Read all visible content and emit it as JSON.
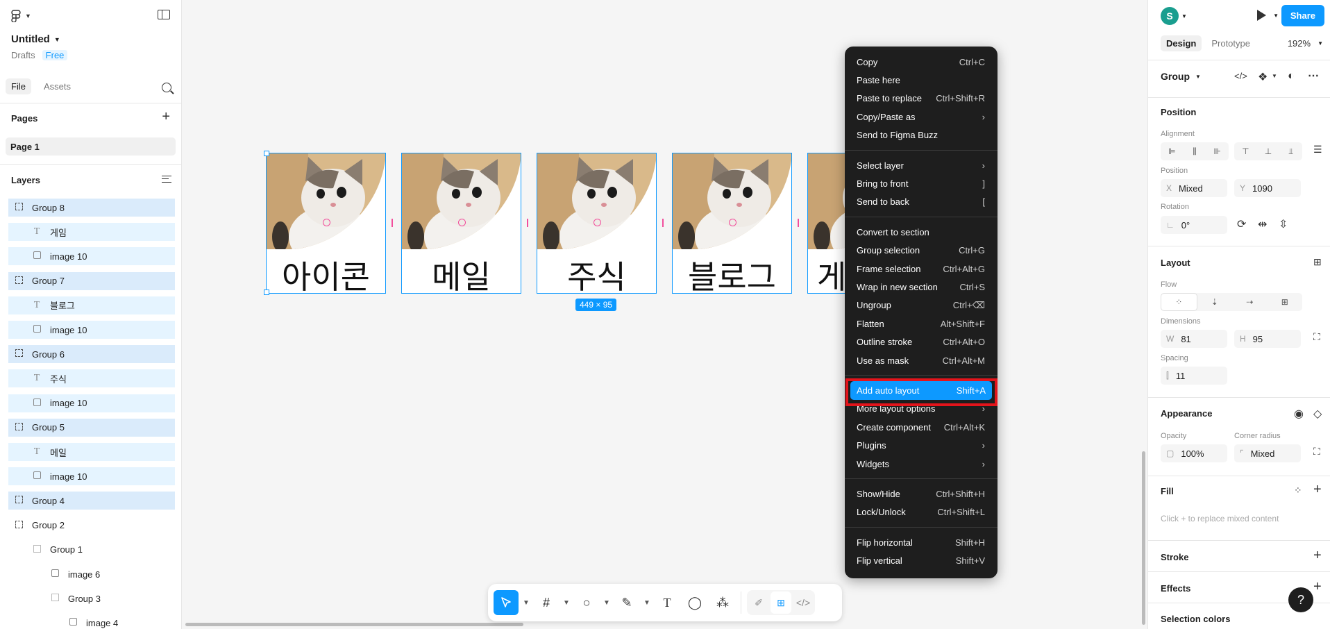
{
  "app": {
    "file_name": "Untitled",
    "location": "Drafts",
    "plan_badge": "Free"
  },
  "left_panel": {
    "tabs": [
      "File",
      "Assets"
    ],
    "pages_header": "Pages",
    "current_page": "Page 1",
    "layers_header": "Layers",
    "layers": [
      {
        "name": "Group 8",
        "type": "group",
        "indent": 0,
        "selected": true
      },
      {
        "name": "게임",
        "type": "text",
        "indent": 1,
        "selected": true
      },
      {
        "name": "image 10",
        "type": "image",
        "indent": 1,
        "selected": true
      },
      {
        "name": "Group 7",
        "type": "group",
        "indent": 0,
        "selected": true
      },
      {
        "name": "블로그",
        "type": "text",
        "indent": 1,
        "selected": true
      },
      {
        "name": "image 10",
        "type": "image",
        "indent": 1,
        "selected": true
      },
      {
        "name": "Group 6",
        "type": "group",
        "indent": 0,
        "selected": true
      },
      {
        "name": "주식",
        "type": "text",
        "indent": 1,
        "selected": true
      },
      {
        "name": "image 10",
        "type": "image",
        "indent": 1,
        "selected": true
      },
      {
        "name": "Group 5",
        "type": "group",
        "indent": 0,
        "selected": true
      },
      {
        "name": "메일",
        "type": "text",
        "indent": 1,
        "selected": true
      },
      {
        "name": "image 10",
        "type": "image",
        "indent": 1,
        "selected": true
      },
      {
        "name": "Group 4",
        "type": "group",
        "indent": 0,
        "selected": true
      },
      {
        "name": "Group 2",
        "type": "group",
        "indent": 0,
        "selected": false
      },
      {
        "name": "Group 1",
        "type": "frame",
        "indent": 1,
        "selected": false
      },
      {
        "name": "image 6",
        "type": "image",
        "indent": 2,
        "selected": false
      },
      {
        "name": "Group 3",
        "type": "frame",
        "indent": 2,
        "selected": false
      },
      {
        "name": "image 4",
        "type": "image",
        "indent": 3,
        "selected": false
      }
    ]
  },
  "canvas": {
    "cards": [
      {
        "label": "아이콘"
      },
      {
        "label": "메일"
      },
      {
        "label": "주식"
      },
      {
        "label": "블로그"
      },
      {
        "label": "게"
      }
    ],
    "selection_size": "449 × 95"
  },
  "context_menu": {
    "groups": [
      [
        {
          "label": "Copy",
          "shortcut": "Ctrl+C"
        },
        {
          "label": "Paste here",
          "shortcut": ""
        },
        {
          "label": "Paste to replace",
          "shortcut": "Ctrl+Shift+R"
        },
        {
          "label": "Copy/Paste as",
          "shortcut": "",
          "submenu": true
        },
        {
          "label": "Send to Figma Buzz",
          "shortcut": ""
        }
      ],
      [
        {
          "label": "Select layer",
          "shortcut": "",
          "submenu": true
        },
        {
          "label": "Bring to front",
          "shortcut": "]"
        },
        {
          "label": "Send to back",
          "shortcut": "["
        }
      ],
      [
        {
          "label": "Convert to section",
          "shortcut": ""
        },
        {
          "label": "Group selection",
          "shortcut": "Ctrl+G"
        },
        {
          "label": "Frame selection",
          "shortcut": "Ctrl+Alt+G"
        },
        {
          "label": "Wrap in new section",
          "shortcut": "Ctrl+S"
        },
        {
          "label": "Ungroup",
          "shortcut": "Ctrl+⌫"
        },
        {
          "label": "Flatten",
          "shortcut": "Alt+Shift+F"
        },
        {
          "label": "Outline stroke",
          "shortcut": "Ctrl+Alt+O"
        },
        {
          "label": "Use as mask",
          "shortcut": "Ctrl+Alt+M"
        }
      ],
      [
        {
          "label": "Add auto layout",
          "shortcut": "Shift+A",
          "highlighted": true
        },
        {
          "label": "More layout options",
          "shortcut": "",
          "submenu": true
        },
        {
          "label": "Create component",
          "shortcut": "Ctrl+Alt+K"
        },
        {
          "label": "Plugins",
          "shortcut": "",
          "submenu": true
        },
        {
          "label": "Widgets",
          "shortcut": "",
          "submenu": true
        }
      ],
      [
        {
          "label": "Show/Hide",
          "shortcut": "Ctrl+Shift+H"
        },
        {
          "label": "Lock/Unlock",
          "shortcut": "Ctrl+Shift+L"
        }
      ],
      [
        {
          "label": "Flip horizontal",
          "shortcut": "Shift+H"
        },
        {
          "label": "Flip vertical",
          "shortcut": "Shift+V"
        }
      ]
    ]
  },
  "right_panel": {
    "avatar_initial": "S",
    "share_label": "Share",
    "tabs": [
      "Design",
      "Prototype"
    ],
    "zoom": "192%",
    "selection_type": "Group",
    "position": {
      "header": "Position",
      "alignment_label": "Alignment",
      "position_label": "Position",
      "x_label": "X",
      "x_value": "Mixed",
      "y_label": "Y",
      "y_value": "1090",
      "rotation_label": "Rotation",
      "rotation_value": "0°"
    },
    "layout": {
      "header": "Layout",
      "flow_label": "Flow",
      "dimensions_label": "Dimensions",
      "w_label": "W",
      "w_value": "81",
      "h_label": "H",
      "h_value": "95",
      "spacing_label": "Spacing",
      "spacing_value": "11"
    },
    "appearance": {
      "header": "Appearance",
      "opacity_label": "Opacity",
      "opacity_value": "100%",
      "corner_label": "Corner radius",
      "corner_value": "Mixed"
    },
    "fill": {
      "header": "Fill",
      "placeholder": "Click + to replace mixed content"
    },
    "stroke_header": "Stroke",
    "effects_header": "Effects",
    "selection_colors_header": "Selection colors"
  },
  "colors": {
    "accent": "#0d99ff",
    "menu_bg": "#1e1e1e",
    "highlight_box": "#e3141b"
  }
}
